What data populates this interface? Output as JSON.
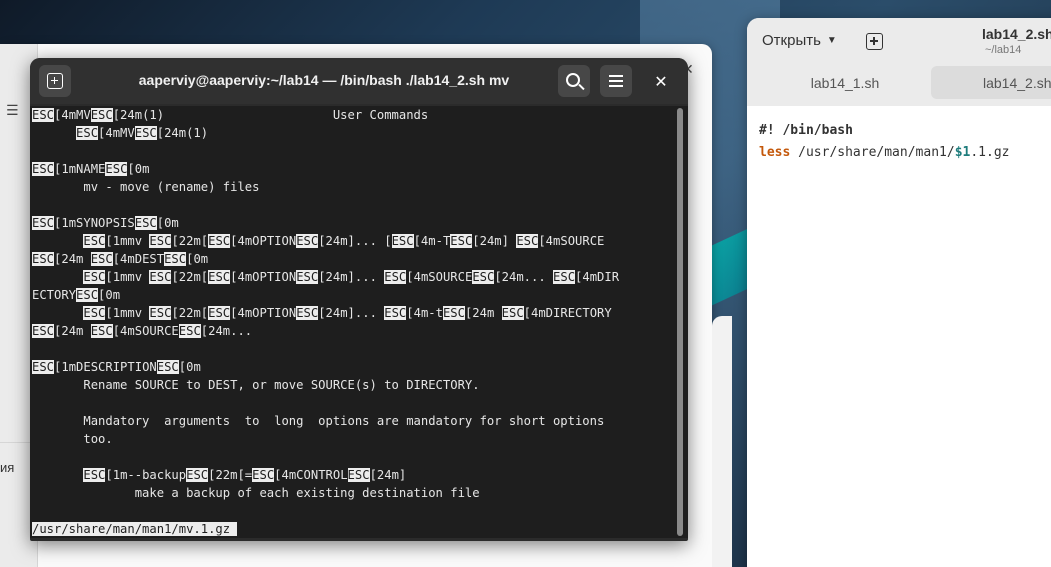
{
  "background_window": {
    "side_label": "ия"
  },
  "editor": {
    "open_label": "Открыть",
    "title": "lab14_2.sh",
    "subtitle": "~/lab14",
    "tabs": [
      {
        "label": "lab14_1.sh"
      },
      {
        "label": "lab14_2.sh"
      }
    ],
    "code": {
      "line1": "#! /bin/bash",
      "line2_cmd": "less",
      "line2_path": " /usr/share/man/man1/",
      "line2_var": "$1",
      "line2_ext": ".1.gz"
    }
  },
  "terminal": {
    "title": "aaperviy@aaperviy:~/lab14 — /bin/bash ./lab14_2.sh mv",
    "esc": "ESC",
    "status_line": "/usr/share/man/man1/mv.1.gz ",
    "lines": {
      "l1a": "[4mMV",
      "l1b": "[24m(1)                       User Commands",
      "l2pre": "      ",
      "l2a": "[4mMV",
      "l2b": "[24m(1)",
      "l4a": "[1mNAME",
      "l4b": "[0m",
      "l5": "       mv - move (rename) files",
      "l7a": "[1mSYNOPSIS",
      "l7b": "[0m",
      "l8pre": "       ",
      "l8a": "[1mmv ",
      "l8b": "[22m[",
      "l8c": "[4mOPTION",
      "l8d": "[24m]... [",
      "l8e": "[4m-T",
      "l8f": "[24m] ",
      "l8g": "[4mSOURCE",
      "l9a": "[24m ",
      "l9b": "[4mDEST",
      "l9c": "[0m",
      "l10pre": "       ",
      "l10a": "[1mmv ",
      "l10b": "[22m[",
      "l10c": "[4mOPTION",
      "l10d": "[24m]... ",
      "l10e": "[4mSOURCE",
      "l10f": "[24m... ",
      "l10g": "[4mDIR",
      "l11a": "ECTORY",
      "l11b": "[0m",
      "l12pre": "       ",
      "l12a": "[1mmv ",
      "l12b": "[22m[",
      "l12c": "[4mOPTION",
      "l12d": "[24m]... ",
      "l12e": "[4m-t",
      "l12f": "[24m ",
      "l12g": "[4mDIRECTORY",
      "l13a": "[24m ",
      "l13b": "[4mSOURCE",
      "l13c": "[24m...",
      "l15a": "[1mDESCRIPTION",
      "l15b": "[0m",
      "l16": "       Rename SOURCE to DEST, or move SOURCE(s) to DIRECTORY.",
      "l18": "       Mandatory  arguments  to  long  options are mandatory for short options",
      "l19": "       too.",
      "l21pre": "       ",
      "l21a": "[1m--backup",
      "l21b": "[22m[=",
      "l21c": "[4mCONTROL",
      "l21d": "[24m]",
      "l22": "              make a backup of each existing destination file"
    }
  }
}
